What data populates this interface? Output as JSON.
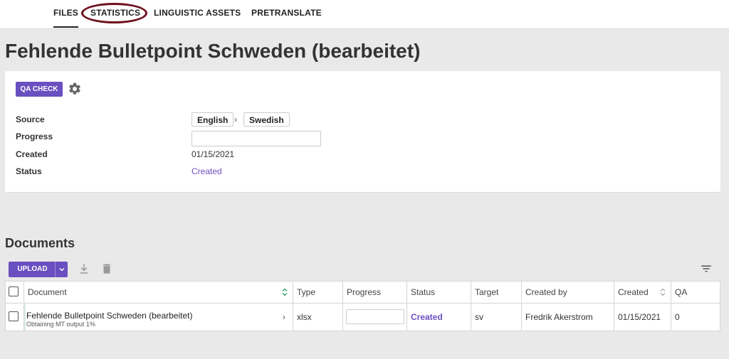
{
  "nav": {
    "tabs": [
      {
        "label": "FILES",
        "active": true
      },
      {
        "label": "STATISTICS",
        "active": false,
        "annotated": true
      },
      {
        "label": "LINGUISTIC ASSETS",
        "active": false
      },
      {
        "label": "PRETRANSLATE",
        "active": false
      }
    ]
  },
  "project": {
    "title": "Fehlende Bulletpoint Schweden (bearbeitet)",
    "qa_check_label": "QA CHECK",
    "settings_icon": "gear-icon",
    "fields": {
      "source_label": "Source",
      "source_lang": "English",
      "target_lang": "Swedish",
      "progress_label": "Progress",
      "progress_value": 0,
      "created_label": "Created",
      "created_value": "01/15/2021",
      "status_label": "Status",
      "status_value": "Created"
    }
  },
  "documents": {
    "title": "Documents",
    "upload_label": "UPLOAD",
    "toolbar_icons": [
      "download-icon",
      "trash-icon",
      "filter-icon"
    ],
    "columns": [
      "Document",
      "Type",
      "Progress",
      "Status",
      "Target",
      "Created by",
      "Created",
      "QA"
    ],
    "rows": [
      {
        "name": "Fehlende Bulletpoint Schweden (bearbeitet)",
        "subtitle": "Obtaining MT output 1%",
        "type": "xlsx",
        "progress": 0,
        "status": "Created",
        "target": "sv",
        "created_by": "Fredrik Akerstrom",
        "created": "01/15/2021",
        "qa": "0"
      }
    ]
  },
  "colors": {
    "accent": "#6a4fc0",
    "annotation": "#6e0f1c",
    "background": "#e9e9e9"
  }
}
